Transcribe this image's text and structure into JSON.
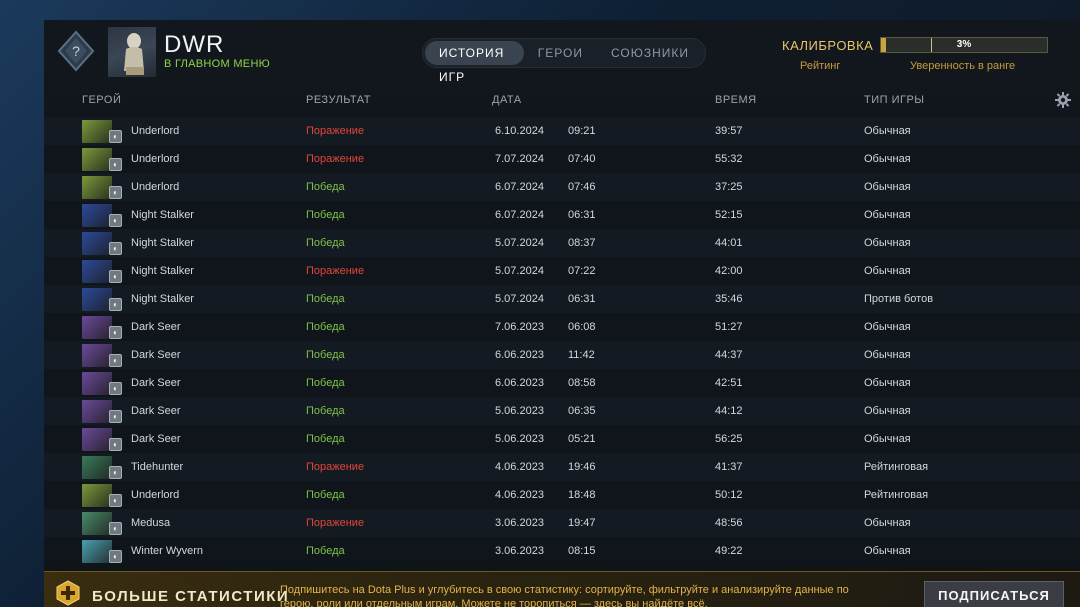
{
  "profile": {
    "username": "DWR",
    "status": "В ГЛАВНОМ МЕНЮ"
  },
  "tabs": [
    {
      "label": "ИСТОРИЯ ИГР",
      "active": true
    },
    {
      "label": "ГЕРОИ",
      "active": false
    },
    {
      "label": "СОЮЗНИКИ",
      "active": false
    }
  ],
  "calibration": {
    "title": "КАЛИБРОВКА",
    "rating_label": "Рейтинг",
    "confidence_label": "Уверенность в ранге",
    "confidence_value": "3%",
    "confidence_fraction": 0.03
  },
  "table": {
    "headers": {
      "hero": "ГЕРОЙ",
      "result": "РЕЗУЛЬТАТ",
      "date": "ДАТА",
      "duration": "ВРЕМЯ",
      "mode": "ТИП ИГРЫ"
    },
    "rows": [
      {
        "hero": "Underlord",
        "result": "Поражение",
        "win": false,
        "date": "6.10.2024",
        "time": "09:21",
        "duration": "39:57",
        "mode": "Обычная"
      },
      {
        "hero": "Underlord",
        "result": "Поражение",
        "win": false,
        "date": "7.07.2024",
        "time": "07:40",
        "duration": "55:32",
        "mode": "Обычная"
      },
      {
        "hero": "Underlord",
        "result": "Победа",
        "win": true,
        "date": "6.07.2024",
        "time": "07:46",
        "duration": "37:25",
        "mode": "Обычная"
      },
      {
        "hero": "Night Stalker",
        "result": "Победа",
        "win": true,
        "date": "6.07.2024",
        "time": "06:31",
        "duration": "52:15",
        "mode": "Обычная"
      },
      {
        "hero": "Night Stalker",
        "result": "Победа",
        "win": true,
        "date": "5.07.2024",
        "time": "08:37",
        "duration": "44:01",
        "mode": "Обычная"
      },
      {
        "hero": "Night Stalker",
        "result": "Поражение",
        "win": false,
        "date": "5.07.2024",
        "time": "07:22",
        "duration": "42:00",
        "mode": "Обычная"
      },
      {
        "hero": "Night Stalker",
        "result": "Победа",
        "win": true,
        "date": "5.07.2024",
        "time": "06:31",
        "duration": "35:46",
        "mode": "Против ботов"
      },
      {
        "hero": "Dark Seer",
        "result": "Победа",
        "win": true,
        "date": "7.06.2023",
        "time": "06:08",
        "duration": "51:27",
        "mode": "Обычная"
      },
      {
        "hero": "Dark Seer",
        "result": "Победа",
        "win": true,
        "date": "6.06.2023",
        "time": "11:42",
        "duration": "44:37",
        "mode": "Обычная"
      },
      {
        "hero": "Dark Seer",
        "result": "Победа",
        "win": true,
        "date": "6.06.2023",
        "time": "08:58",
        "duration": "42:51",
        "mode": "Обычная"
      },
      {
        "hero": "Dark Seer",
        "result": "Победа",
        "win": true,
        "date": "5.06.2023",
        "time": "06:35",
        "duration": "44:12",
        "mode": "Обычная"
      },
      {
        "hero": "Dark Seer",
        "result": "Победа",
        "win": true,
        "date": "5.06.2023",
        "time": "05:21",
        "duration": "56:25",
        "mode": "Обычная"
      },
      {
        "hero": "Tidehunter",
        "result": "Поражение",
        "win": false,
        "date": "4.06.2023",
        "time": "19:46",
        "duration": "41:37",
        "mode": "Рейтинговая"
      },
      {
        "hero": "Underlord",
        "result": "Победа",
        "win": true,
        "date": "4.06.2023",
        "time": "18:48",
        "duration": "50:12",
        "mode": "Рейтинговая"
      },
      {
        "hero": "Medusa",
        "result": "Поражение",
        "win": false,
        "date": "3.06.2023",
        "time": "19:47",
        "duration": "48:56",
        "mode": "Обычная"
      },
      {
        "hero": "Winter Wyvern",
        "result": "Победа",
        "win": true,
        "date": "3.06.2023",
        "time": "08:15",
        "duration": "49:22",
        "mode": "Обычная"
      }
    ]
  },
  "hero_colors": {
    "Underlord": "#7a9a3a",
    "Night Stalker": "#2c4a9a",
    "Dark Seer": "#6a4a9a",
    "Tidehunter": "#3a7a5a",
    "Medusa": "#4a8a6a",
    "Winter Wyvern": "#4aa0b0"
  },
  "banner": {
    "title": "БОЛЬШЕ СТАТИСТИКИ",
    "text": "Подпишитесь на Dota Plus и углубитесь в свою статистику: сортируйте, фильтруйте и анализируйте данные по герою, роли или отдельным играм. Можете не торопиться — здесь вы найдёте всё.",
    "button": "ПОДПИСАТЬСЯ"
  }
}
